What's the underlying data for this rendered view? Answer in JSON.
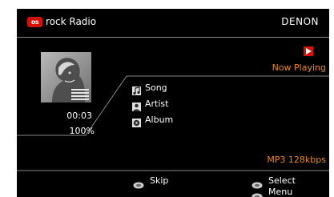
{
  "header": {
    "logo_text": "os",
    "title": "rock Radio",
    "brand": "DENON"
  },
  "album_art": {
    "icon": "album-art-placeholder"
  },
  "playback": {
    "time": "00:03",
    "buffer": "100%",
    "status": "Now Playing",
    "status_icon": "play-icon",
    "bitrate": "MP3 128kbps"
  },
  "track": {
    "song_label": "Song",
    "artist_label": "Artist",
    "album_label": "Album"
  },
  "controls": {
    "skip_label": "Skip",
    "select_label": "Select",
    "menu_label": "Menu"
  },
  "colors": {
    "accent": "#f08a00",
    "brand_red": "#d51007",
    "background": "#000000",
    "text": "#ffffff",
    "divider": "#8a8a8a"
  }
}
